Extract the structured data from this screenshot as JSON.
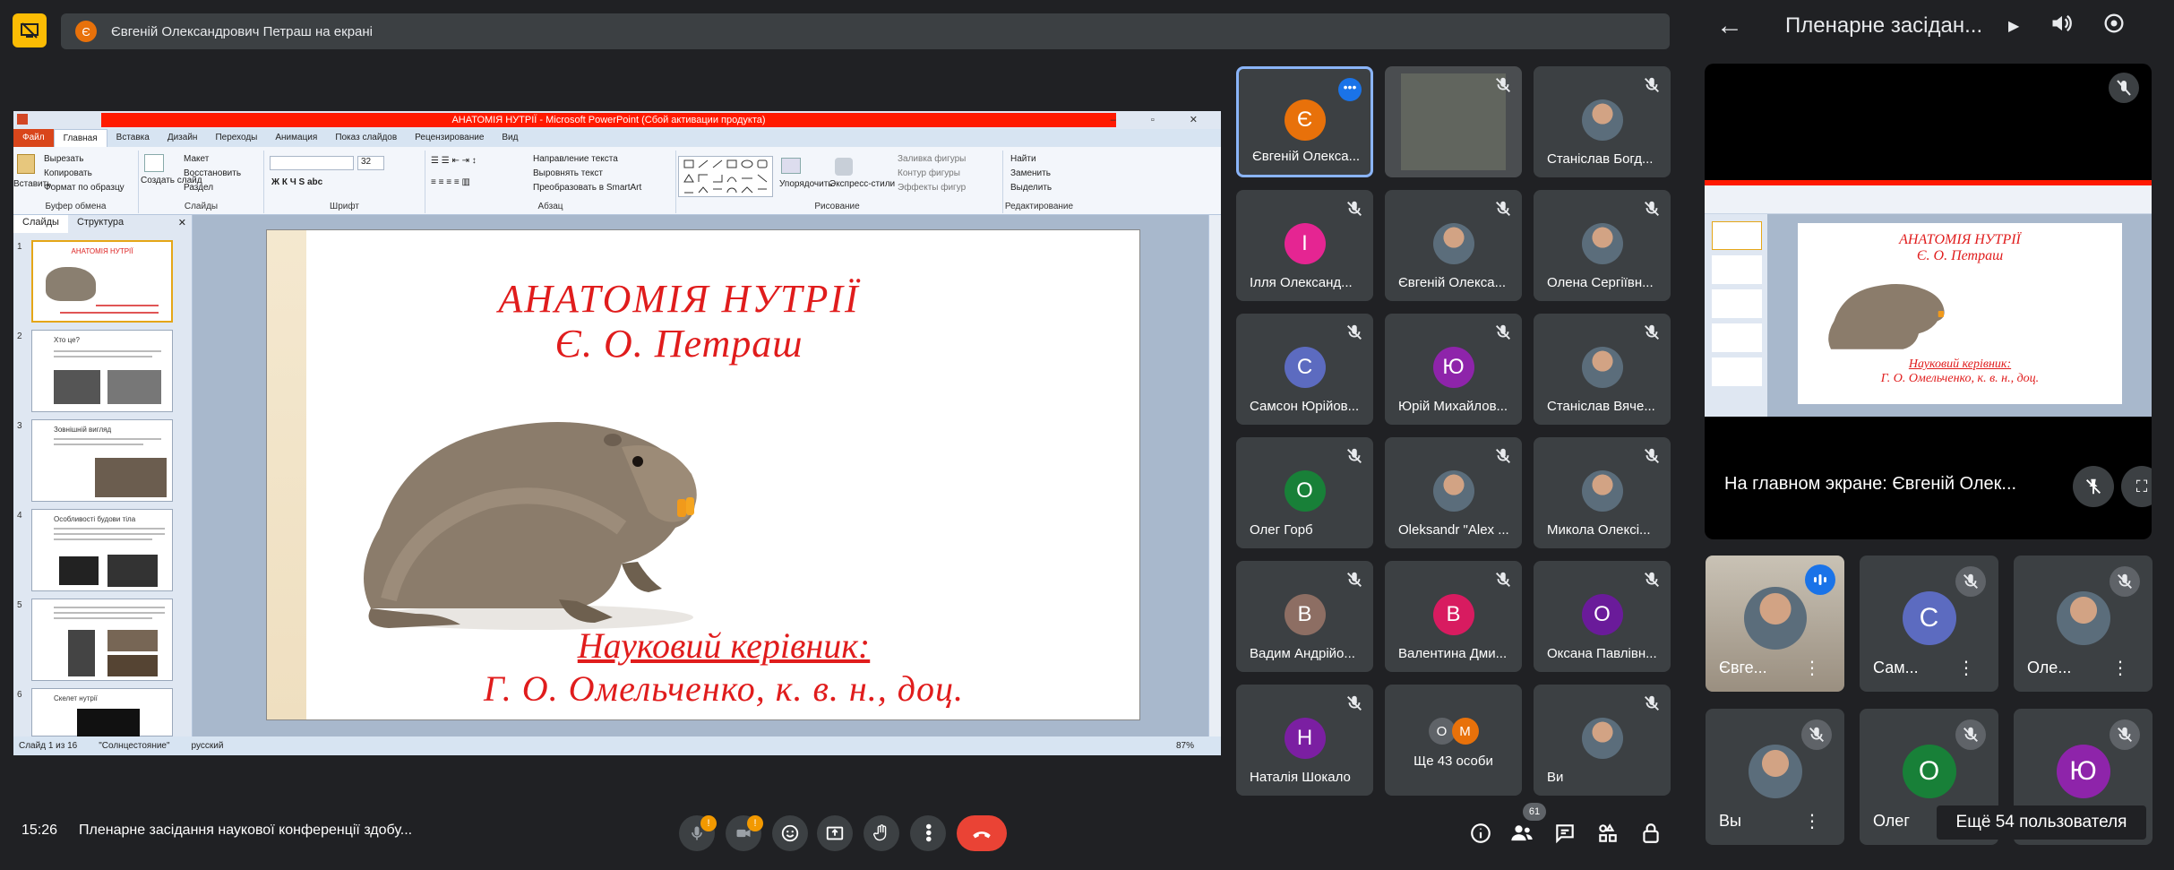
{
  "banner": {
    "presenter_initial": "Є",
    "text": "Євгеній Олександрович Петраш на екрані"
  },
  "powerpoint": {
    "window_title": "АНАТОМІЯ НУТРІЇ - Microsoft PowerPoint (Сбой активации продукта)",
    "tabs": [
      "Файл",
      "Главная",
      "Вставка",
      "Дизайн",
      "Переходы",
      "Анимация",
      "Показ слайдов",
      "Рецензирование",
      "Вид"
    ],
    "active_tab": "Главная",
    "ribbon": {
      "paste": "Вставить",
      "cut": "Вырезать",
      "copy": "Копировать",
      "format_painter": "Формат по образцу",
      "clipboard": "Буфер обмена",
      "new_slide": "Создать слайд",
      "layout": "Макет",
      "reset": "Восстановить",
      "section": "Раздел",
      "slides_group": "Слайды",
      "font_group": "Шрифт",
      "paragraph_group": "Абзац",
      "text_direction": "Направление текста",
      "align_text": "Выровнять текст",
      "convert_smartart": "Преобразовать в SmartArt",
      "arrange": "Упорядочить",
      "quick_styles": "Экспресс-стили",
      "shape_fill": "Заливка фигуры",
      "shape_outline": "Контур фигуры",
      "shape_effects": "Эффекты фигур",
      "drawing_group": "Рисование",
      "find": "Найти",
      "replace": "Заменить",
      "select": "Выделить",
      "editing_group": "Редактирование",
      "font_size": "32"
    },
    "panel_tabs": [
      "Слайды",
      "Структура"
    ],
    "thumbnails": [
      {
        "num": "1",
        "title": "АНАТОМІЯ НУТРІЇ"
      },
      {
        "num": "2",
        "title": "Хто це?"
      },
      {
        "num": "3",
        "title": "Зовнішній вигляд"
      },
      {
        "num": "4",
        "title": "Особливості будови тіла"
      },
      {
        "num": "5",
        "title": ""
      },
      {
        "num": "6",
        "title": "Скелет нутрії"
      }
    ],
    "slide": {
      "title_line1": "АНАТОМІЯ НУТРІЇ",
      "title_line2": "Є. О. Петраш",
      "supervisor_label": "Науковий керівник:",
      "supervisor_name": "Г. О. Омельченко, к. в. н., доц."
    },
    "status": {
      "slide_count": "Слайд 1 из 16",
      "theme": "\"Солнцестояние\"",
      "language": "русский",
      "zoom": "87%"
    }
  },
  "participants": [
    {
      "name": "Євгеній Олекса...",
      "initial": "Є",
      "color": "#e8710a",
      "photo": false,
      "active": true
    },
    {
      "name": "",
      "initial": "",
      "color": "",
      "photo": false,
      "dim": true
    },
    {
      "name": "Станіслав Богд...",
      "initial": "",
      "color": "",
      "photo": true
    },
    {
      "name": "Ілля Олександ...",
      "initial": "І",
      "color": "#e52592",
      "photo": false
    },
    {
      "name": "Євгеній Олекса...",
      "initial": "",
      "color": "",
      "photo": true
    },
    {
      "name": "Олена Сергіївн...",
      "initial": "",
      "color": "",
      "photo": true
    },
    {
      "name": "Самсон Юрійов...",
      "initial": "С",
      "color": "#5c6bc0",
      "photo": false
    },
    {
      "name": "Юрій Михайлов...",
      "initial": "Ю",
      "color": "#8e24aa",
      "photo": false
    },
    {
      "name": "Станіслав Вяче...",
      "initial": "",
      "color": "",
      "photo": true
    },
    {
      "name": "Олег Горб",
      "initial": "О",
      "color": "#188038",
      "photo": false
    },
    {
      "name": "Oleksandr \"Alex ...",
      "initial": "",
      "color": "",
      "photo": true
    },
    {
      "name": "Микола Олексі...",
      "initial": "",
      "color": "",
      "photo": true
    },
    {
      "name": "Вадим Андрійо...",
      "initial": "В",
      "color": "#8d6e63",
      "photo": false
    },
    {
      "name": "Валентина Дми...",
      "initial": "В",
      "color": "#d81b60",
      "photo": false
    },
    {
      "name": "Оксана Павлівн...",
      "initial": "О",
      "color": "#6a1b9a",
      "photo": false
    },
    {
      "name": "Наталія Шокало",
      "initial": "Н",
      "color": "#7b1fa2",
      "photo": false
    },
    {
      "name": "Ще 43 особи",
      "initial": "",
      "color": "",
      "photo": false,
      "group": true
    },
    {
      "name": "Ви",
      "initial": "",
      "color": "",
      "photo": true
    }
  ],
  "right_panel": {
    "title": "Пленарне засідан...",
    "stage_name": "На главном экране: Євгеній Олек...",
    "tiles": [
      {
        "name": "Євге...",
        "initial": "",
        "color": "",
        "photo": true,
        "speaking": true
      },
      {
        "name": "Сам...",
        "initial": "С",
        "color": "#5c6bc0",
        "photo": false
      },
      {
        "name": "Оле...",
        "initial": "",
        "color": "",
        "photo": true
      },
      {
        "name": "Вы",
        "initial": "",
        "color": "",
        "photo": true
      },
      {
        "name": "Олег",
        "initial": "О",
        "color": "#188038",
        "photo": false
      },
      {
        "name": "",
        "initial": "Ю",
        "color": "#8e24aa",
        "photo": false
      }
    ],
    "more_users": "Ещё 54 пользователя"
  },
  "bottom": {
    "time": "15:26",
    "meeting_name": "Пленарне засідання наукової конференції здобу...",
    "mic_badge": "!",
    "cam_badge": "!",
    "people_count": "61"
  }
}
